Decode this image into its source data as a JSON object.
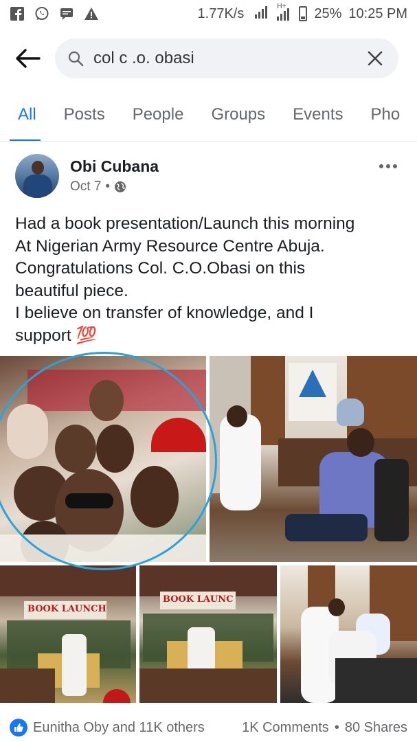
{
  "status_bar": {
    "speed": "1.77K/s",
    "network": "H+",
    "battery": "25%",
    "time": "10:25 PM",
    "left_icons": [
      "facebook-icon",
      "whatsapp-icon",
      "message-icon",
      "warning-icon"
    ]
  },
  "search": {
    "query": "col c .o. obasi"
  },
  "tabs": [
    {
      "label": "All",
      "active": true
    },
    {
      "label": "Posts"
    },
    {
      "label": "People"
    },
    {
      "label": "Groups"
    },
    {
      "label": "Events"
    },
    {
      "label": "Pho"
    }
  ],
  "post": {
    "author": "Obi Cubana",
    "date": "Oct 7",
    "dot": "•",
    "text_lines": [
      "Had a book presentation/Launch this morning",
      "At Nigerian Army Resource Centre Abuja.",
      "Congratulations Col. C.O.Obasi on this",
      "beautiful piece.",
      "I believe on transfer of knowledge, and I",
      "support 💯"
    ],
    "photo_texts": {
      "banner_1": "BOOK LAUNCH",
      "banner_2": "BOOK LAUNC"
    }
  },
  "reactions": {
    "liked_by": "Eunitha Oby and 11K others",
    "comments": "1K Comments",
    "separator": "•",
    "shares": "80 Shares"
  },
  "colors": {
    "accent": "#1877f2",
    "annotation_circle": "#2aa3dc"
  }
}
